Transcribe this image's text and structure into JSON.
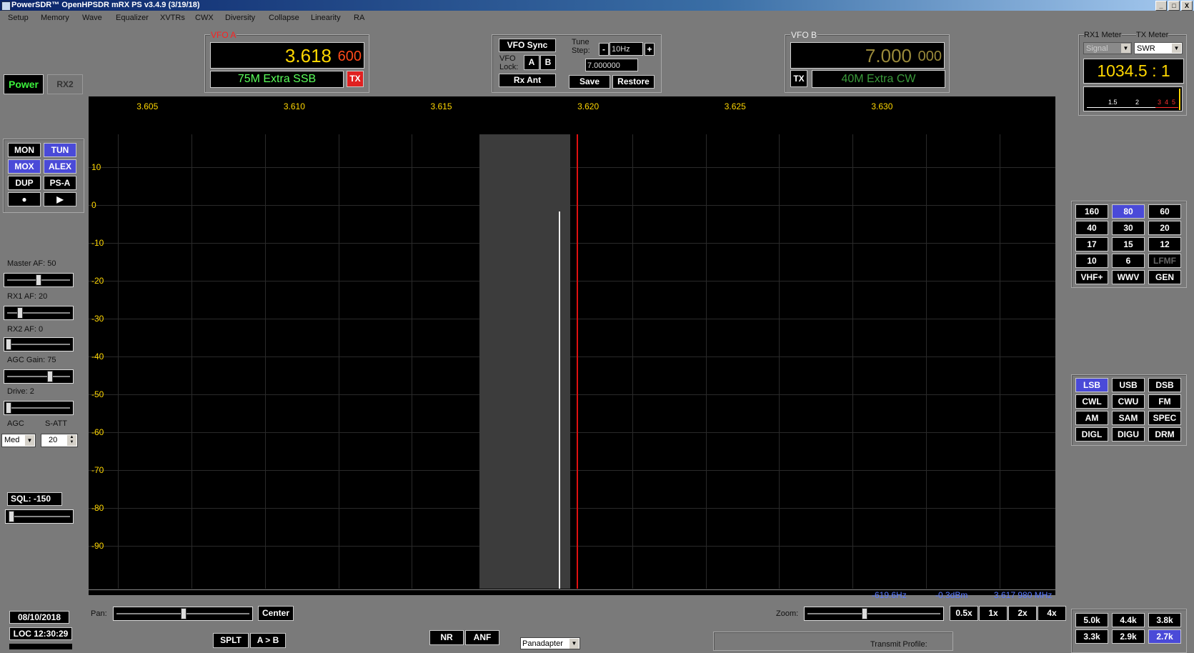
{
  "title": "PowerSDR™ OpenHPSDR mRX PS v3.4.9 (3/19/18)",
  "window_controls": [
    "_",
    "□",
    "X"
  ],
  "menu": [
    "Setup",
    "Memory",
    "Wave",
    "Equalizer",
    "XVTRs",
    "CWX",
    "Diversity",
    "Collapse",
    "Linearity",
    "RA"
  ],
  "left": {
    "power": "Power",
    "rx2": "RX2",
    "buttons": [
      "MON",
      "TUN",
      "MOX",
      "ALEX",
      "DUP",
      "PS-A",
      "●",
      "▶"
    ],
    "sliders": [
      {
        "label": "Master AF:  50",
        "pos": 0.45
      },
      {
        "label": "RX1 AF:  20",
        "pos": 0.2
      },
      {
        "label": "RX2 AF:  0",
        "pos": 0.0
      },
      {
        "label": "AGC Gain:  75",
        "pos": 0.62
      },
      {
        "label": "Drive:  2",
        "pos": 0.02
      }
    ],
    "agc_label": "AGC",
    "satt_label": "S-ATT",
    "agc_value": "Med",
    "satt_value": "20",
    "sql": "SQL: -150",
    "date": "08/10/2018",
    "time": "LOC 12:30:29"
  },
  "vfoa": {
    "label": "VFO A",
    "freq_main": "3.618",
    "freq_sub": "600",
    "band": "75M Extra SSB",
    "tx": "TX"
  },
  "vfo_sync": {
    "sync": "VFO Sync",
    "lock": "VFO Lock:",
    "a": "A",
    "b": "B",
    "rxant": "Rx Ant",
    "tune_step": "Tune Step:",
    "minus": "-",
    "step": "10Hz",
    "plus": "+",
    "freq": "7.000000",
    "save": "Save",
    "restore": "Restore"
  },
  "vfob": {
    "label": "VFO B",
    "freq_main": "7.000",
    "freq_sub": "000",
    "band": "40M Extra CW",
    "tx": "TX"
  },
  "meter": {
    "rx1": "RX1 Meter",
    "tx": "TX Meter",
    "rx1_sel": "Signal",
    "tx_sel": "SWR",
    "value": "1034.5 : 1",
    "scale": [
      "1.5",
      "2",
      "3",
      "4",
      "5"
    ]
  },
  "bands": [
    [
      "160",
      "80",
      "60"
    ],
    [
      "40",
      "30",
      "20"
    ],
    [
      "17",
      "15",
      "12"
    ],
    [
      "10",
      "6",
      "LFMF"
    ],
    [
      "VHF+",
      "WWV",
      "GEN"
    ]
  ],
  "band_selected": "80",
  "band_disabled": "LFMF",
  "modes": [
    [
      "LSB",
      "USB",
      "DSB"
    ],
    [
      "CWL",
      "CWU",
      "FM"
    ],
    [
      "AM",
      "SAM",
      "SPEC"
    ],
    [
      "DIGL",
      "DIGU",
      "DRM"
    ]
  ],
  "mode_selected": "LSB",
  "filters": [
    [
      "5.0k",
      "4.4k",
      "3.8k"
    ],
    [
      "3.3k",
      "2.9k",
      "2.7k"
    ]
  ],
  "filter_selected": "2.7k",
  "panadapter": {
    "x_ticks": [
      "3.605",
      "3.610",
      "3.615",
      "3.620",
      "3.625",
      "3.630"
    ],
    "y_ticks": [
      "10",
      "0",
      "-10",
      "-20",
      "-30",
      "-40",
      "-50",
      "-60",
      "-70",
      "-80",
      "-90"
    ],
    "readout_offset": "-619.6Hz",
    "readout_level": "-0.3dBm",
    "readout_freq": "3.617 980 MHz"
  },
  "bottom": {
    "pan": "Pan:",
    "center": "Center",
    "zoom": "Zoom:",
    "zooms": [
      "0.5x",
      "1x",
      "2x",
      "4x"
    ],
    "splt": "SPLT",
    "ab": "A > B",
    "nr": "NR",
    "anf": "ANF",
    "display_mode": "Panadapter",
    "transmit_profile": "Transmit Profile:"
  }
}
